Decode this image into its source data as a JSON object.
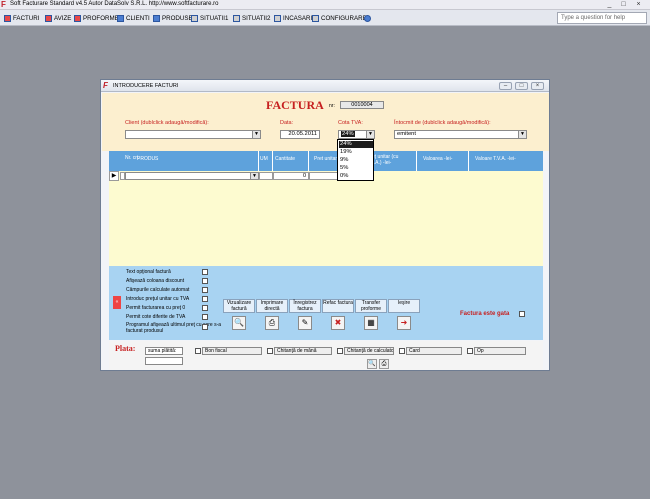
{
  "app": {
    "title": "Soft Facturare Standard v4.5 Autor DataSolv S.R.L. http://www.softfacturare.ro",
    "logo": "F",
    "controls": [
      "_",
      "□",
      "×"
    ]
  },
  "menu": {
    "items": [
      {
        "label": "FACTURI",
        "icon": "invoice-icon"
      },
      {
        "label": "AVIZE",
        "icon": "delivery-note-icon"
      },
      {
        "label": "PROFORME",
        "icon": "proforma-icon"
      },
      {
        "label": "CLIENTI",
        "icon": "clients-icon"
      },
      {
        "label": "PRODUSE",
        "icon": "products-icon"
      },
      {
        "label": "SITUATII1",
        "icon": "report-icon"
      },
      {
        "label": "SITUATII2",
        "icon": "report-icon"
      },
      {
        "label": "INCASARI",
        "icon": "cash-icon"
      },
      {
        "label": "CONFIGURARE",
        "icon": "gear-icon"
      }
    ],
    "help_placeholder": "Type a question for help"
  },
  "dialog": {
    "logo": "F",
    "title": "INTRODUCERE FACTURI",
    "controls": [
      "–",
      "□",
      "×"
    ],
    "form_title": "FACTURA",
    "nr_label": "nr:",
    "nr_value": "0010004",
    "client_label": "Client (dublclick adaugă/modifică):",
    "client_value": "",
    "date_label": "Data:",
    "date_value": "20.05.2011",
    "vat_label": "Cota TVA:",
    "vat_value": "24%",
    "prepared_label": "Întocmit de (dublclick adaugă/modifică):",
    "prepared_value": "emitent",
    "vat_options": [
      "24%",
      "19%",
      "9%",
      "5%",
      "0%"
    ],
    "vat_selected_index": 0
  },
  "grid": {
    "headers": {
      "nr": "Nr. crt.",
      "produs": "PRODUS",
      "um": "UM",
      "cantitate": "Cantitate",
      "pret_unitar": "Pret unitar",
      "pret_unitar_tva": "Preţ unitar (cu T.V.A.) -lei-",
      "valoarea": "Valoarea -lei-",
      "valoare_tva": "Valoare T.V.A. -lei-"
    },
    "row": {
      "selector": "▶",
      "produs": "",
      "cantitate": "0"
    }
  },
  "options": {
    "checkboxes": [
      "Text opţional factură",
      "Afişează coloana discount",
      "Câmpurile calculate automat",
      "Introduc preţul unitar cu TVA",
      "Permit facturarea cu preţ 0",
      "Permit cote diferite de TVA",
      "Programul afişează ultimul preţ cu care s-a facturat produsul"
    ],
    "collapse": "«",
    "actions": [
      {
        "label": "Vizualizare factură",
        "icon": "preview-icon",
        "glyph": "🔍"
      },
      {
        "label": "Imprimare directă",
        "icon": "printer-icon",
        "glyph": "⎙"
      },
      {
        "label": "Înregistrez factura",
        "icon": "save-icon",
        "glyph": "✎"
      },
      {
        "label": "Refac factura",
        "icon": "redo-icon",
        "glyph": "✖"
      },
      {
        "label": "Transfer proforme",
        "icon": "transfer-icon",
        "glyph": "▦"
      },
      {
        "label": "Ieşire",
        "icon": "exit-icon",
        "glyph": "➜"
      }
    ],
    "factura_gata": "Factura este gata"
  },
  "payment": {
    "label": "Plata:",
    "sum_label": "suma plătită:",
    "sum_value": "",
    "methods": [
      "Bon fiscal",
      "Chitanţă de mână",
      "Chitanţă de calculator",
      "Card",
      "Op"
    ]
  },
  "colors": {
    "accent_red": "#c62020",
    "grid_header": "#5ea2dc",
    "grid_body": "#fdfbd0",
    "options_bg": "#a8d3f2",
    "header_bg": "#fcefcf"
  }
}
